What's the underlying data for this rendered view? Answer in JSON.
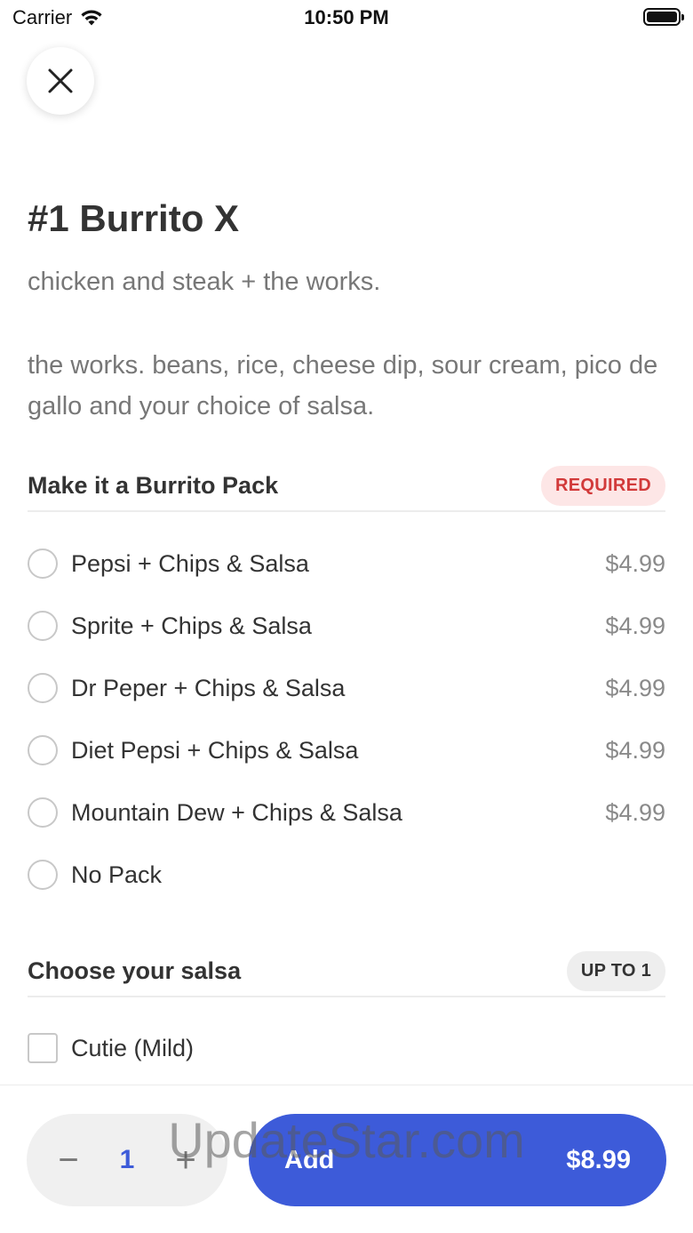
{
  "status_bar": {
    "carrier": "Carrier",
    "time": "10:50 PM"
  },
  "item": {
    "title": "#1 Burrito X",
    "subtitle": "chicken and steak + the works.",
    "description": "the works. beans, rice, cheese dip, sour cream, pico de gallo and your choice of salsa."
  },
  "pack_section": {
    "title": "Make it a Burrito Pack",
    "badge": "REQUIRED",
    "options": [
      {
        "label": "Pepsi + Chips & Salsa",
        "price": "$4.99"
      },
      {
        "label": "Sprite + Chips & Salsa",
        "price": "$4.99"
      },
      {
        "label": "Dr Peper + Chips & Salsa",
        "price": "$4.99"
      },
      {
        "label": "Diet Pepsi + Chips & Salsa",
        "price": "$4.99"
      },
      {
        "label": "Mountain Dew + Chips & Salsa",
        "price": "$4.99"
      },
      {
        "label": "No Pack",
        "price": ""
      }
    ]
  },
  "salsa_section": {
    "title": "Choose your salsa",
    "badge": "UP TO 1",
    "options": [
      {
        "label": "Cutie (Mild)"
      }
    ]
  },
  "bottom_bar": {
    "minus": "−",
    "quantity": "1",
    "plus": "+",
    "add_label": "Add",
    "add_price": "$8.99"
  },
  "watermark": "UpdateStar.com",
  "colors": {
    "accent": "#3d5bd9",
    "required_text": "#d23a3a",
    "required_bg": "#fde6e6"
  }
}
